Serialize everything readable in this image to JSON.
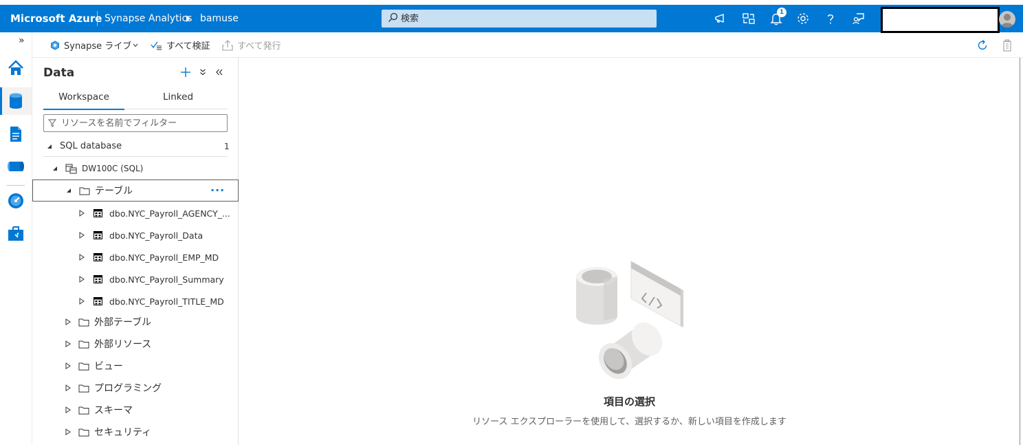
{
  "topbar": {
    "brand": "Microsoft Azure",
    "breadcrumb_service": "Synapse Analytics",
    "breadcrumb_workspace": "bamuse",
    "search_placeholder": "検索",
    "notification_count": "1"
  },
  "rail": {
    "expand_label": "»",
    "items": [
      "home-icon",
      "data-icon",
      "develop-icon",
      "integrate-icon",
      "monitor-icon",
      "manage-icon"
    ]
  },
  "commandbar": {
    "live_label": "Synapse ライブ",
    "validate_all_label": "すべて検証",
    "publish_all_label": "すべて発行"
  },
  "data_panel": {
    "title": "Data",
    "tabs": [
      {
        "label": "Workspace",
        "active": true
      },
      {
        "label": "Linked",
        "active": false
      }
    ],
    "filter_placeholder": "リソースを名前でフィルター",
    "section": {
      "label": "SQL database",
      "count": "1"
    },
    "database": "DW100C (SQL)",
    "tables_folder": "テーブル",
    "more_label": "···",
    "tables": [
      "dbo.NYC_Payroll_AGENCY_...",
      "dbo.NYC_Payroll_Data",
      "dbo.NYC_Payroll_EMP_MD",
      "dbo.NYC_Payroll_Summary",
      "dbo.NYC_Payroll_TITLE_MD"
    ],
    "folders": [
      "外部テーブル",
      "外部リソース",
      "ビュー",
      "プログラミング",
      "スキーマ",
      "セキュリティ"
    ]
  },
  "main": {
    "empty_title": "項目の選択",
    "empty_subtitle": "リソース エクスプローラーを使用して、選択するか、新しい項目を作成します"
  },
  "colors": {
    "accent": "#0078d4",
    "search_bg": "#c7e0f4"
  }
}
